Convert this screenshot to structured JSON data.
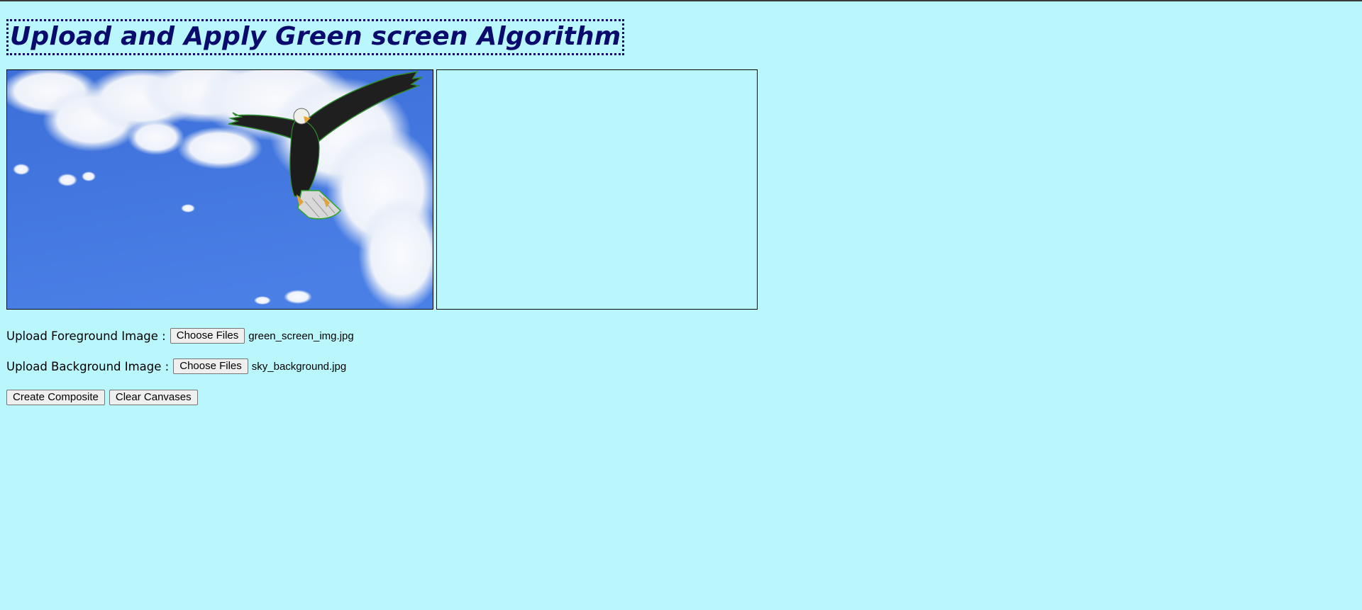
{
  "page": {
    "title": "Upload and Apply Green screen Algorithm",
    "background_color": "#baf7fc",
    "title_color": "#0b0b6e"
  },
  "canvases": {
    "left": {
      "content": "composite image: bald eagle flying over blue sky with clouds",
      "sky_color": "#3f73dd"
    },
    "right": {
      "content": "empty"
    }
  },
  "uploads": {
    "foreground": {
      "label": "Upload Foreground Image :",
      "button_label": "Choose Files",
      "file_name": "green_screen_img.jpg"
    },
    "background": {
      "label": "Upload Background Image :",
      "button_label": "Choose Files",
      "file_name": "sky_background.jpg"
    }
  },
  "actions": {
    "create_label": "Create Composite",
    "clear_label": "Clear Canvases"
  }
}
